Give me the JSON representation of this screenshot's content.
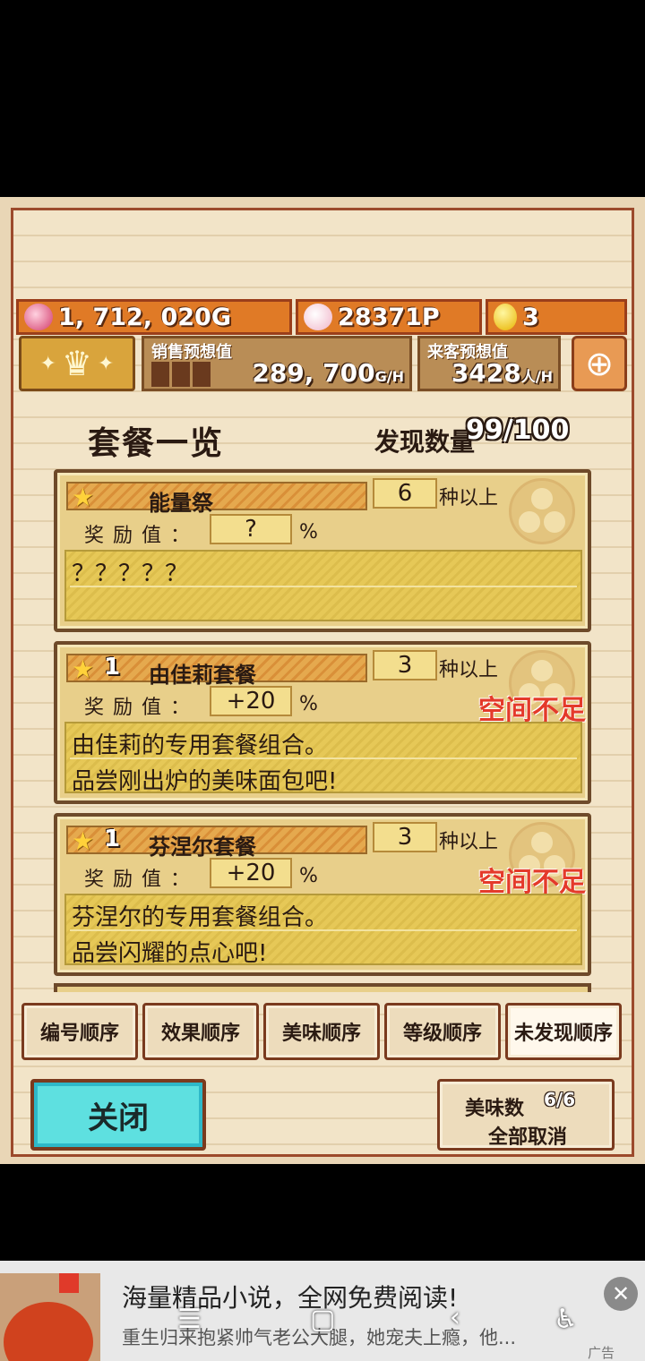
{
  "status": {
    "gold": "1, 712, 020G",
    "points": "28371P",
    "eggs": "3"
  },
  "predictions": {
    "sales_label": "销售预想值",
    "sales_value": "289, 700",
    "sales_unit": "G/H",
    "visitors_label": "来客预想值",
    "visitors_value": "3428",
    "visitors_unit": "人/H"
  },
  "header": {
    "title": "套餐一览",
    "discovered_label": "发现数量",
    "discovered_count": "99/100"
  },
  "cards": [
    {
      "level": "",
      "name": "能量祭",
      "required": "6",
      "required_suffix": "种以上",
      "reward_label": "奖励值：",
      "reward_value": "?",
      "reward_unit": "%",
      "warning": "",
      "desc_line1": "？？？？？",
      "desc_line2": ""
    },
    {
      "level": "1",
      "name": "由佳莉套餐",
      "required": "3",
      "required_suffix": "种以上",
      "reward_label": "奖励值：",
      "reward_value": "+20",
      "reward_unit": "%",
      "warning": "空间不足",
      "desc_line1": "由佳莉的专用套餐组合。",
      "desc_line2": "品尝刚出炉的美味面包吧!"
    },
    {
      "level": "1",
      "name": "芬涅尔套餐",
      "required": "3",
      "required_suffix": "种以上",
      "reward_label": "奖励值：",
      "reward_value": "+20",
      "reward_unit": "%",
      "warning": "空间不足",
      "desc_line1": "芬涅尔的专用套餐组合。",
      "desc_line2": "品尝闪耀的点心吧!"
    }
  ],
  "sort_buttons": [
    "编号顺序",
    "效果顺序",
    "美味顺序",
    "等级顺序",
    "未发现顺序"
  ],
  "close_label": "关闭",
  "cancel": {
    "count_label": "美味数",
    "count_value": "6/6",
    "cancel_all": "全部取消"
  },
  "ad": {
    "headline": "海量精品小说，全网免费阅读!",
    "sub": "重生归来抱紧帅气老公大腿，她宠夫上瘾，他...",
    "tag": "广告",
    "close_icon": "close-icon"
  },
  "colors": {
    "warning": "#e43a2a",
    "close_button": "#5ee0e0",
    "status_bar": "#e07a26"
  }
}
